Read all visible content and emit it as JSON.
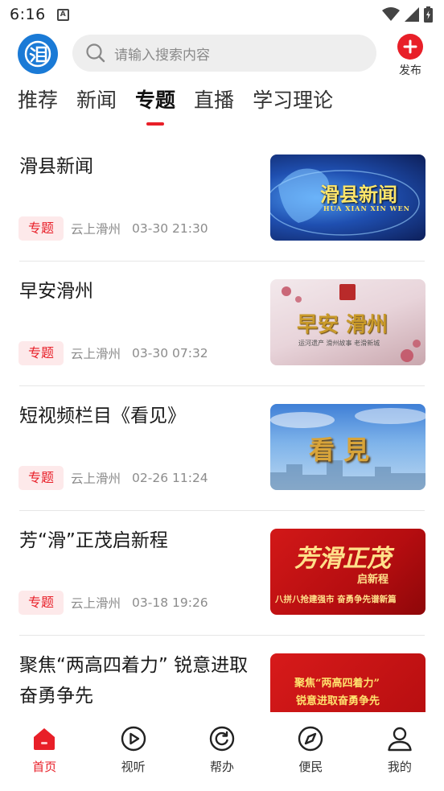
{
  "status_bar": {
    "time": "6:16",
    "notification": "A"
  },
  "header": {
    "logo_char": "滑",
    "search_placeholder": "请输入搜索内容",
    "publish_label": "发布"
  },
  "tabs": [
    {
      "label": "推荐",
      "active": false
    },
    {
      "label": "新闻",
      "active": false
    },
    {
      "label": "专题",
      "active": true
    },
    {
      "label": "直播",
      "active": false
    },
    {
      "label": "学习理论",
      "active": false
    }
  ],
  "feed": [
    {
      "title": "滑县新闻",
      "tag": "专题",
      "source": "云上滑州",
      "time": "03-30 21:30",
      "thumb": {
        "main": "滑县新闻",
        "sub": "HUA XIAN XIN WEN"
      }
    },
    {
      "title": "早安滑州",
      "tag": "专题",
      "source": "云上滑州",
      "time": "03-30 07:32",
      "thumb": {
        "main": "早安 滑州",
        "sub": "运河遗产 滑州故事 老滑新城"
      }
    },
    {
      "title": "短视频栏目《看见》",
      "tag": "专题",
      "source": "云上滑州",
      "time": "02-26 11:24",
      "thumb": {
        "main": "看 見",
        "sub": ""
      }
    },
    {
      "title": "芳“滑”正茂启新程",
      "tag": "专题",
      "source": "云上滑州",
      "time": "03-18 19:26",
      "thumb": {
        "main": "芳滑正茂",
        "sub": "启新程",
        "banner": "八拼八抢建强市 奋勇争先谱新篇"
      }
    },
    {
      "title": "聚焦“两高四着力” 锐意进取奋勇争先",
      "tag": "",
      "source": "",
      "time": "",
      "thumb": {
        "main": "聚焦“两高四着力”",
        "sub": "锐意进取奋勇争先"
      }
    }
  ],
  "bottom_nav": [
    {
      "label": "首页",
      "icon": "home-icon",
      "active": true
    },
    {
      "label": "视听",
      "icon": "play-icon",
      "active": false
    },
    {
      "label": "帮办",
      "icon": "refresh-icon",
      "active": false
    },
    {
      "label": "便民",
      "icon": "compass-icon",
      "active": false
    },
    {
      "label": "我的",
      "icon": "user-icon",
      "active": false
    }
  ],
  "colors": {
    "accent": "#e81f28",
    "logo_blue": "#1a7ad6",
    "tag_bg": "#fde9ea"
  }
}
